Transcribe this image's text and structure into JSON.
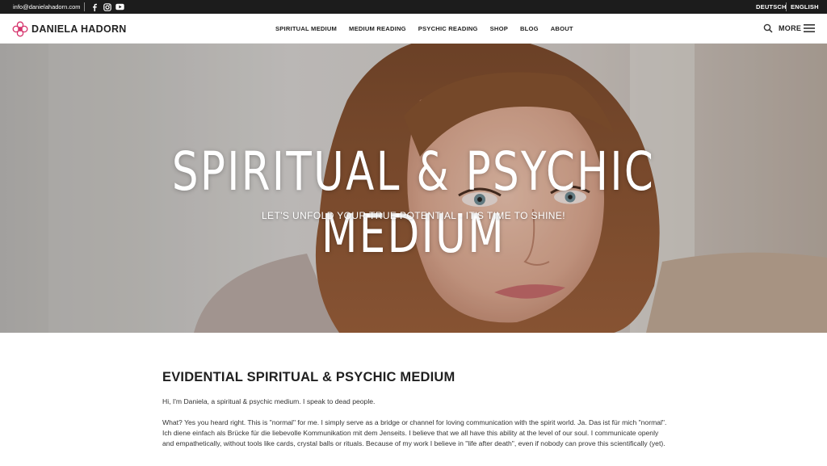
{
  "topbar": {
    "email": "info@danielahadorn.com",
    "social": [
      "facebook-icon",
      "instagram-icon",
      "youtube-icon"
    ],
    "languages": [
      "DEUTSCH",
      "ENGLISH"
    ]
  },
  "brand": {
    "name": "DANIELA HADORN",
    "accent": "#d6336c"
  },
  "nav": {
    "items": [
      "SPIRITUAL MEDIUM",
      "MEDIUM READING",
      "PSYCHIC READING",
      "SHOP",
      "BLOG",
      "ABOUT"
    ],
    "more_label": "MORE"
  },
  "hero": {
    "title": "SPIRITUAL & PSYCHIC MEDIUM",
    "subtitle": "LET'S UNFOLD YOUR TRUE POTENTIAL - IT'S TIME TO SHINE!"
  },
  "content": {
    "heading": "EVIDENTIAL SPIRITUAL & PSYCHIC MEDIUM",
    "intro": "Hi, I'm Daniela, a spiritual & psychic medium. I speak to dead people.",
    "paragraph": "What? Yes you heard right. This is \"normal\" for me. I simply serve as a bridge or channel for loving communication with the spirit world. Ja. Das ist für mich \"normal\". Ich diene einfach als Brücke für die liebevolle Kommunikation mit dem Jenseits. I believe that we all have this ability at the level of our soul. I communicate openly and empathetically, without tools like cards, crystal balls or rituals. Because of my work I believe in \"life after death\", even if nobody can prove this scientifically (yet)."
  }
}
